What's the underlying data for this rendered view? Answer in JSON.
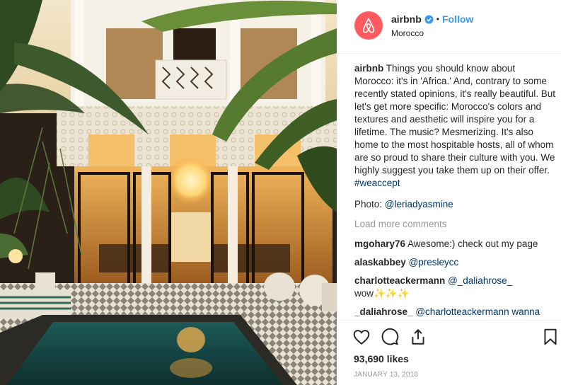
{
  "post": {
    "username": "airbnb",
    "follow_label": "Follow",
    "separator": "•",
    "location": "Morocco",
    "verified_icon": "verified-badge-icon",
    "brand_color": "#ff5a5f",
    "link_color": "#3897f0"
  },
  "caption": {
    "username": "airbnb",
    "text": "Things you should know about Morocco: it's in 'Africa.' And, contrary to some recently stated opinions, it's really beautiful. But let's get more specific: Morocco's colors and textures and aesthetic will inspire you for a lifetime. The music? Mesmerizing. It's also home to the most hospitable hosts, all of whom are so proud to share their culture with you. We highly suggest you take them up on their offer.",
    "hashtag": "#weaccept"
  },
  "credit": {
    "label": "Photo:",
    "mention": "@leriadyasmine"
  },
  "load_more": "Load more comments",
  "comments": [
    {
      "username": "mgohary76",
      "text": "Awesome:) check out my page"
    },
    {
      "username": "alaskabbey",
      "mention": "@presleycc"
    },
    {
      "username": "charlotteackermann",
      "mention": "@_daliahrose_",
      "text": "wow✨✨✨"
    },
    {
      "username": "_daliahrose_",
      "mention": "@charlotteackermann wanna"
    }
  ],
  "actions": {
    "like_icon": "heart-icon",
    "comment_icon": "comment-icon",
    "share_icon": "share-icon",
    "save_icon": "bookmark-icon"
  },
  "likes": "93,690 likes",
  "date": "JANUARY 13, 2018"
}
